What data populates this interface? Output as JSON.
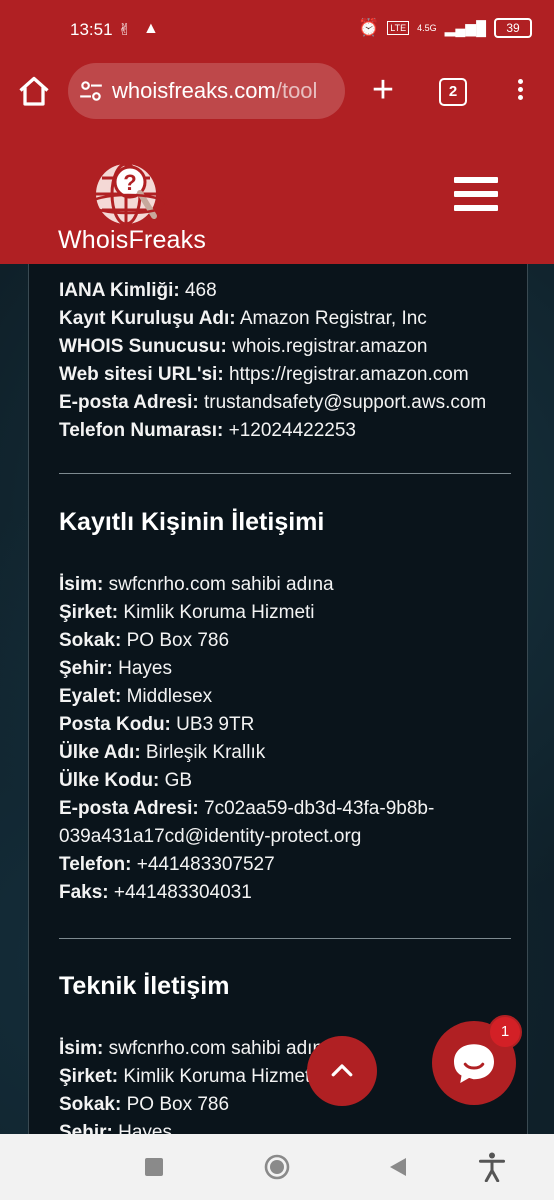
{
  "status_bar": {
    "time": "13:51",
    "battery": "39",
    "signal": "4.5G"
  },
  "browser": {
    "url_host": "whoisfreaks.com",
    "url_rest": "/tool",
    "tab_count": "2"
  },
  "site": {
    "logo_text": "WhoisFreaks",
    "accent_color": "#b02023"
  },
  "registrar": {
    "rows": [
      {
        "label": "IANA Kimliği:",
        "value": "468"
      },
      {
        "label": "Kayıt Kuruluşu Adı:",
        "value": "Amazon Registrar, Inc"
      },
      {
        "label": "WHOIS Sunucusu:",
        "value": "whois.registrar.amazon"
      },
      {
        "label": "Web sitesi URL'si:",
        "value": "https://registrar.amazon.com"
      },
      {
        "label": "E-posta Adresi:",
        "value": "trustandsafety@support.aws.com"
      },
      {
        "label": "Telefon Numarası:",
        "value": "+12024422253"
      }
    ]
  },
  "registrant_contact": {
    "title": "Kayıtlı Kişinin İletişimi",
    "rows": [
      {
        "label": "İsim:",
        "value": "swfcnrho.com sahibi adına"
      },
      {
        "label": "Şirket:",
        "value": "Kimlik Koruma Hizmeti"
      },
      {
        "label": "Sokak:",
        "value": "PO Box 786"
      },
      {
        "label": "Şehir:",
        "value": "Hayes"
      },
      {
        "label": "Eyalet:",
        "value": "Middlesex"
      },
      {
        "label": "Posta Kodu:",
        "value": "UB3 9TR"
      },
      {
        "label": "Ülke Adı:",
        "value": "Birleşik Krallık"
      },
      {
        "label": "Ülke Kodu:",
        "value": "GB"
      },
      {
        "label": "E-posta Adresi:",
        "value": "7c02aa59-db3d-43fa-9b8b-"
      },
      {
        "label": "",
        "value": "039a431a17cd@identity-protect.org"
      },
      {
        "label": "Telefon:",
        "value": "+441483307527"
      },
      {
        "label": "Faks:",
        "value": "+441483304031"
      }
    ]
  },
  "technical_contact": {
    "title": "Teknik İletişim",
    "rows": [
      {
        "label": "İsim:",
        "value": "swfcnrho.com sahibi adına"
      },
      {
        "label": "Şirket:",
        "value": "Kimlik Koruma Hizmeti"
      },
      {
        "label": "Sokak:",
        "value": "PO Box 786"
      },
      {
        "label": "Şehir:",
        "value": "Hayes"
      }
    ]
  },
  "chat": {
    "badge_count": "1"
  },
  "icons": {
    "home": "home-icon",
    "site_settings": "tune-icon",
    "new_tab": "plus-icon",
    "tabs": "tabs-icon",
    "overflow": "more-vert-icon",
    "menu": "hamburger-icon",
    "scroll_top": "chevron-up-icon",
    "chat": "chat-icon",
    "nav_recents": "square-icon",
    "nav_home": "circle-icon",
    "nav_back": "triangle-back-icon",
    "accessibility": "accessibility-icon"
  }
}
